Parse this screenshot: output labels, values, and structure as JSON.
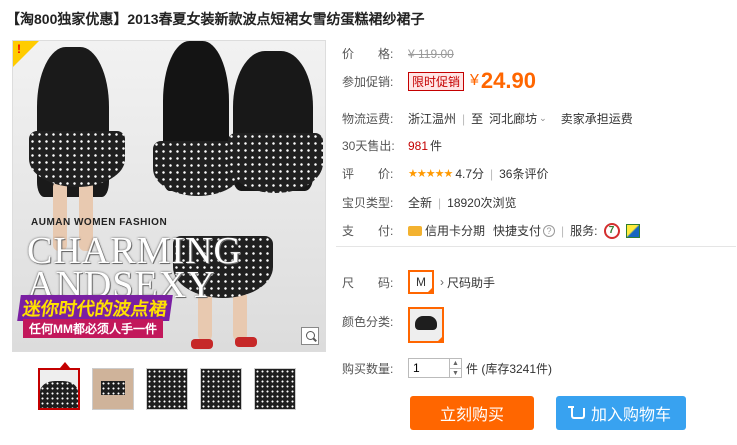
{
  "title": "【淘800独家优惠】2013春夏女装新款波点短裙女雪纺蛋糕裙纱裙子",
  "image": {
    "hot_mark": "!",
    "fashion_line": "AUMAN WOMEN FASHION",
    "headline_1": "CHARMING",
    "headline_2": "ANDSEXY",
    "promo_1": "迷你时代的波点裙",
    "promo_2": "任何MM都必须人手一件"
  },
  "price": {
    "label": "价　　格:",
    "original": "¥ 119.00"
  },
  "promo": {
    "label": "参加促销:",
    "badge": "限时促销",
    "currency": "¥",
    "value": "24.90"
  },
  "shipping": {
    "label": "物流运费:",
    "from": "浙江温州",
    "to_prefix": "至",
    "to": "河北廊坊",
    "fee": "卖家承担运费"
  },
  "sales": {
    "label": "30天售出:",
    "count": "981",
    "unit": "件"
  },
  "rating": {
    "label": "评　　价:",
    "stars": "★★★★★",
    "score": "4.7分",
    "reviews": "36条评价"
  },
  "item_type": {
    "label": "宝贝类型:",
    "condition": "全新",
    "views": "18920次浏览"
  },
  "payment": {
    "label": "支　　付:",
    "credit": "信用卡分期",
    "quick": "快捷支付",
    "qmark": "?",
    "service_label": "服务:",
    "service_7": "7"
  },
  "size": {
    "label": "尺　　码:",
    "selected": "M",
    "helper": "尺码助手",
    "helper_icon": "›"
  },
  "color": {
    "label": "颜色分类:"
  },
  "quantity": {
    "label": "购买数量:",
    "value": "1",
    "up": "▲",
    "down": "▼",
    "stock": "件 (库存3241件)"
  },
  "buttons": {
    "buy": "立刻购买",
    "cart": "加入购物车"
  },
  "colors": {
    "accent": "#ff6600",
    "price_red": "#c40000",
    "cart_blue": "#38a2f0"
  }
}
